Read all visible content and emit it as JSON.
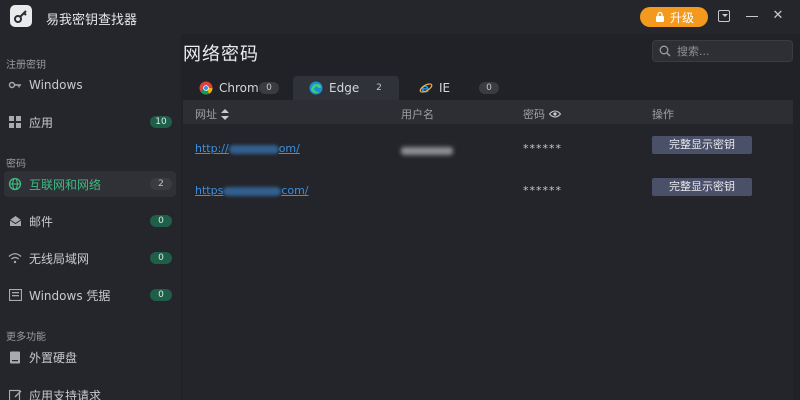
{
  "app": {
    "title": "易我密钥查找器",
    "upgrade_label": "升级"
  },
  "search": {
    "placeholder": "搜索..."
  },
  "page": {
    "title": "网络密码"
  },
  "sidebar": {
    "sections": [
      {
        "label": "注册密钥"
      },
      {
        "label": "密码"
      },
      {
        "label": "更多功能"
      }
    ],
    "items": [
      {
        "label": "Windows",
        "icon": "key-icon",
        "count": ""
      },
      {
        "label": "应用",
        "icon": "apps-grid-icon",
        "count": "10"
      },
      {
        "label": "互联网和网络",
        "icon": "globe-icon",
        "count": "2",
        "active": true
      },
      {
        "label": "邮件",
        "icon": "mail-icon",
        "count": "0"
      },
      {
        "label": "无线局域网",
        "icon": "wifi-icon",
        "count": "0"
      },
      {
        "label": "Windows 凭据",
        "icon": "credential-icon",
        "count": "0"
      },
      {
        "label": "外置硬盘",
        "icon": "external-drive-icon",
        "count": ""
      },
      {
        "label": "应用支持请求",
        "icon": "support-request-icon",
        "count": ""
      }
    ]
  },
  "tabs": [
    {
      "label": "Chrome",
      "count": "0",
      "icon": "chrome-icon"
    },
    {
      "label": "Edge",
      "count": "2",
      "icon": "edge-icon",
      "active": true
    },
    {
      "label": "IE",
      "count": "0",
      "icon": "ie-icon"
    }
  ],
  "table": {
    "headers": {
      "url": "网址",
      "username": "用户名",
      "password": "密码",
      "action": "操作"
    },
    "rows": [
      {
        "url_prefix": "http://",
        "url_suffix": "om/",
        "password": "******",
        "action": "完整显示密钥"
      },
      {
        "url_prefix": "https",
        "url_suffix": "com/",
        "password": "******",
        "action": "完整显示密钥"
      }
    ]
  },
  "colors": {
    "accent_green": "#3fb983",
    "upgrade_orange": "#f39a1e",
    "link_blue": "#3d8fe0",
    "button_slate": "#4a5068"
  }
}
